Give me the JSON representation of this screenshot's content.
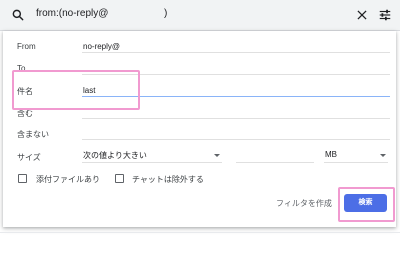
{
  "search": {
    "query": "from:(no-reply@                    )"
  },
  "filters": {
    "from_label": "From",
    "from_value": "no-reply@",
    "to_label": "To",
    "to_value": "",
    "subject_label": "件名",
    "subject_value": "last",
    "has_words_label": "含む",
    "has_words_value": "",
    "doesnt_have_label": "含まない",
    "doesnt_have_value": "",
    "size_label": "サイズ",
    "size_operator": "次の値より大きい",
    "size_value": "",
    "size_unit": "MB",
    "has_attachment_label": "添付ファイルあり",
    "exclude_chats_label": "チャットは除外する",
    "create_filter_label": "フィルタを作成",
    "search_button_label": "検索"
  },
  "icons": {
    "search": "search-icon",
    "close": "close-icon",
    "tune": "tune-icon",
    "dropdown": "caret-down-icon"
  },
  "colors": {
    "search_button": "#4c6ee6",
    "highlight": "#f19ad0",
    "active_underline": "#8ab4f8"
  }
}
